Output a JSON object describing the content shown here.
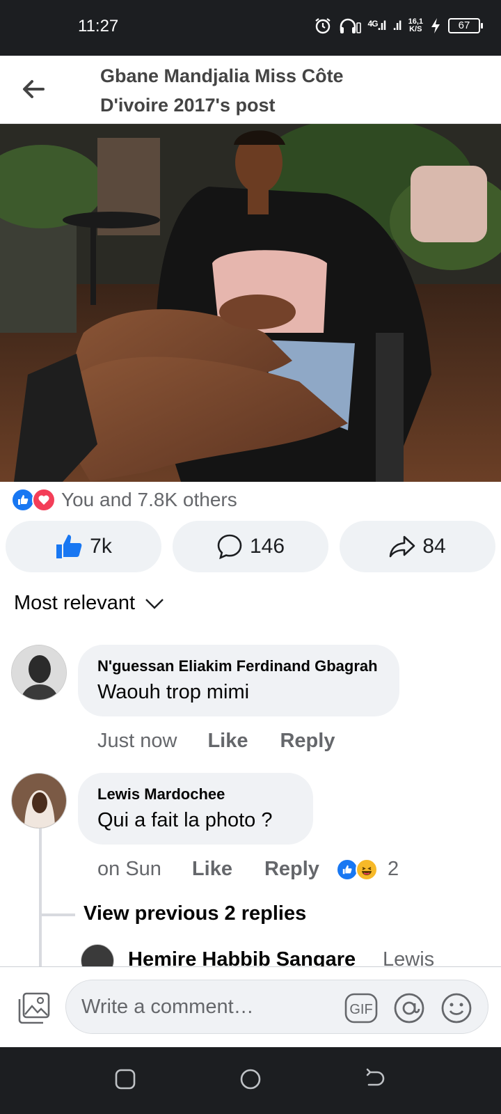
{
  "status_bar": {
    "time": "11:27",
    "network": "4G",
    "speed_value": "16,1",
    "speed_unit": "K/S",
    "battery": "67"
  },
  "header": {
    "title": "Gbane Mandjalia Miss Côte D'ivoire 2017's post"
  },
  "post": {
    "reactions_text": "You and 7.8K others",
    "actions": {
      "like_count": "7k",
      "comment_count": "146",
      "share_count": "84"
    }
  },
  "sort": {
    "label": "Most relevant"
  },
  "comments": [
    {
      "author": "N'guessan Eliakim Ferdinand Gbagrah",
      "text": "Waouh trop mimi",
      "time": "Just now",
      "like_label": "Like",
      "reply_label": "Reply"
    },
    {
      "author": "Lewis Mardochee",
      "text": "Qui a fait la photo ?",
      "time": "on Sun",
      "like_label": "Like",
      "reply_label": "Reply",
      "reaction_count": "2"
    }
  ],
  "view_previous": "View previous 2 replies",
  "partial_reply": {
    "author": "Hemire Habbib Sangare",
    "text": "Lewis"
  },
  "composer": {
    "placeholder": "Write a comment…",
    "gif_label": "GIF"
  },
  "colors": {
    "facebook_blue": "#1877f2",
    "love_red": "#f33e58",
    "bubble_bg": "#f0f2f5",
    "secondary_text": "#65676b",
    "system_bar": "#1c1e21"
  }
}
